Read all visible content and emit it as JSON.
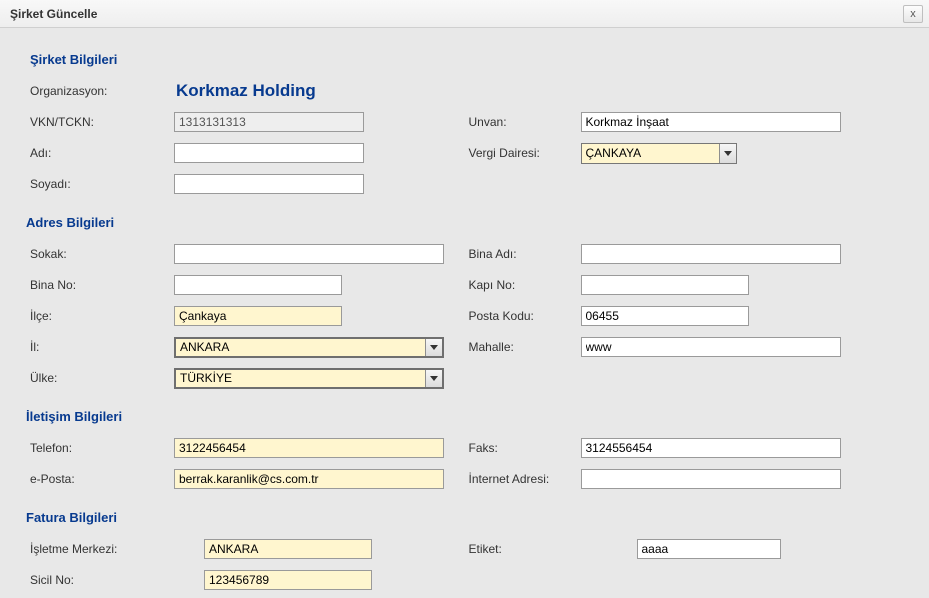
{
  "window": {
    "title": "Şirket Güncelle",
    "close": "x"
  },
  "sections": {
    "company": {
      "title": "Şirket Bilgileri",
      "org_label": "Organizasyon:",
      "org_value": "Korkmaz Holding",
      "vkn_label": "VKN/TCKN:",
      "vkn_value": "1313131313",
      "adi_label": "Adı:",
      "adi_value": "",
      "soyadi_label": "Soyadı:",
      "soyadi_value": "",
      "unvan_label": "Unvan:",
      "unvan_value": "Korkmaz İnşaat",
      "vergi_label": "Vergi Dairesi:",
      "vergi_value": "ÇANKAYA"
    },
    "address": {
      "title": "Adres Bilgileri",
      "sokak_label": "Sokak:",
      "sokak_value": "",
      "bina_no_label": "Bina No:",
      "bina_no_value": "",
      "ilce_label": "İlçe:",
      "ilce_value": "Çankaya",
      "il_label": "İl:",
      "il_value": "ANKARA",
      "ulke_label": "Ülke:",
      "ulke_value": "TÜRKİYE",
      "bina_adi_label": "Bina Adı:",
      "bina_adi_value": "",
      "kapi_no_label": "Kapı No:",
      "kapi_no_value": "",
      "posta_label": "Posta Kodu:",
      "posta_value": "06455",
      "mahalle_label": "Mahalle:",
      "mahalle_value": "www"
    },
    "contact": {
      "title": "İletişim Bilgileri",
      "telefon_label": "Telefon:",
      "telefon_value": "3122456454",
      "eposta_label": "e-Posta:",
      "eposta_value": "berrak.karanlik@cs.com.tr",
      "faks_label": "Faks:",
      "faks_value": "3124556454",
      "internet_label": "İnternet Adresi:",
      "internet_value": ""
    },
    "invoice": {
      "title": "Fatura Bilgileri",
      "isletme_label": "İşletme Merkezi:",
      "isletme_value": "ANKARA",
      "sicil_label": "Sicil No:",
      "sicil_value": "123456789",
      "etiket_label": "Etiket:",
      "etiket_value": "aaaa"
    }
  }
}
